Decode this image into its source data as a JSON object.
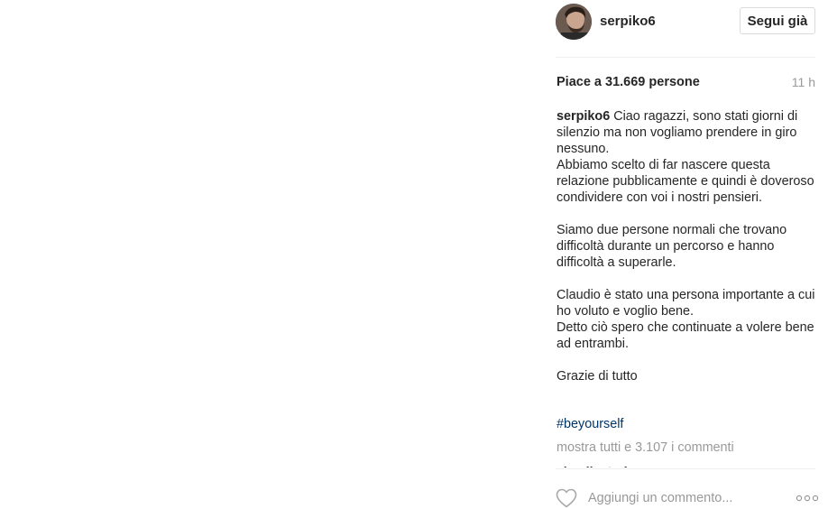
{
  "post": {
    "username": "serpiko6",
    "follow_label": "Segui già",
    "likes": "Piace a 31.669 persone",
    "time": "11 h",
    "caption": {
      "user": "serpiko6",
      "line1": "Ciao ragazzi, sono stati giorni di silenzio ma non vogliamo prendere in giro nessuno.",
      "line2": "Abbiamo scelto di far nascere questa relazione pubblicamente e quindi è doveroso condividere con voi i nostri pensieri.",
      "para2": "Siamo due persone normali che trovano difficoltà durante un percorso e hanno difficoltà a superarle.",
      "para3a": "Claudio è stato una persona importante a cui ho voluto e voglio bene.",
      "para3b": "Detto ciò spero che continuate a volere bene ad entrambi.",
      "para4": "Grazie di tutto"
    },
    "hashtag": "#beyourself",
    "view_all": "mostra tutti e 3.107 i commenti",
    "cut_comment": "claudiosterlo"
  },
  "footer": {
    "comment_placeholder": "Aggiungi un commento...",
    "like_icon": "heart-outline-icon",
    "more_icon": "more-options-icon"
  },
  "colors": {
    "text": "#262626",
    "muted": "#999999",
    "link": "#003569",
    "border": "#dbdbdb"
  }
}
